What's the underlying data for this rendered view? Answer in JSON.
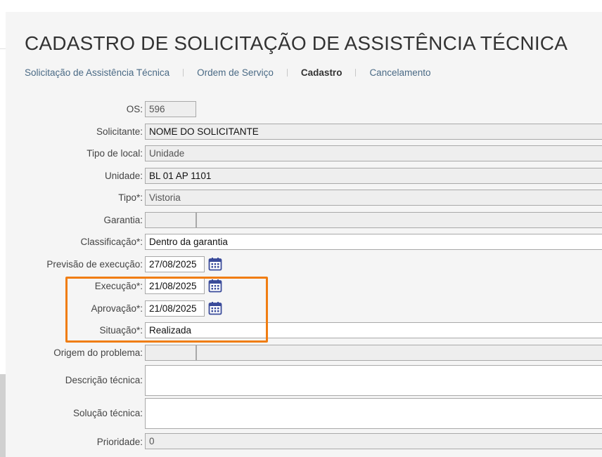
{
  "page": {
    "title": "CADASTRO DE SOLICITAÇÃO DE ASSISTÊNCIA TÉCNICA",
    "breadcrumbs": [
      {
        "label": "Solicitação de Assistência Técnica"
      },
      {
        "label": "Ordem de Serviço"
      },
      {
        "label": "Cadastro"
      },
      {
        "label": "Cancelamento"
      }
    ]
  },
  "form": {
    "os": {
      "label": "OS:",
      "value": "596"
    },
    "solicitante": {
      "label": "Solicitante:",
      "value": "NOME DO SOLICITANTE"
    },
    "tipo_local": {
      "label": "Tipo de local:",
      "value": "Unidade"
    },
    "unidade": {
      "label": "Unidade:",
      "value": "BL 01 AP 1101"
    },
    "tipo": {
      "label": "Tipo*:",
      "value": "Vistoria"
    },
    "garantia": {
      "label": "Garantia:",
      "value": ""
    },
    "classificacao": {
      "label": "Classificação*:",
      "value": "Dentro da garantia"
    },
    "previsao": {
      "label": "Previsão de execução:",
      "value": "27/08/2025"
    },
    "execucao": {
      "label": "Execução*:",
      "value": "21/08/2025"
    },
    "aprovacao": {
      "label": "Aprovação*:",
      "value": "21/08/2025"
    },
    "situacao": {
      "label": "Situação*:",
      "value": "Realizada"
    },
    "origem": {
      "label": "Origem do problema:",
      "value": ""
    },
    "descricao": {
      "label": "Descrição técnica:",
      "value": ""
    },
    "solucao": {
      "label": "Solução técnica:",
      "value": ""
    },
    "prioridade": {
      "label": "Prioridade:",
      "value": "0"
    }
  },
  "icons": {
    "calendar": "calendar-icon"
  },
  "colors": {
    "highlight": "#f07d12",
    "calendar": "#3a4b9a",
    "link": "#4a6a85"
  }
}
